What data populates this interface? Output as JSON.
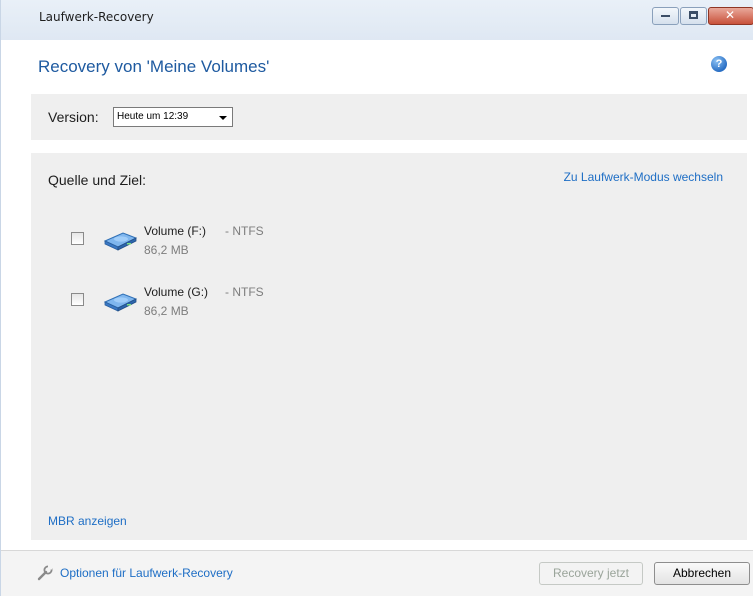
{
  "window": {
    "title": "Laufwerk-Recovery",
    "controls": {
      "minimize": "minimize-icon",
      "maximize": "maximize-icon",
      "close": "close-icon"
    }
  },
  "header": {
    "title": "Recovery von 'Meine Volumes'",
    "help_icon": "help-icon",
    "help_glyph": "?"
  },
  "version": {
    "label": "Version:",
    "selected": "Heute um 12:39"
  },
  "main": {
    "section_title": "Quelle und Ziel:",
    "switch_mode_link": "Zu Laufwerk-Modus wechseln",
    "volumes": [
      {
        "name": "Volume (F:)",
        "filesystem": "- NTFS",
        "size": "86,2 MB",
        "checked": false,
        "icon": "hard-drive-icon"
      },
      {
        "name": "Volume (G:)",
        "filesystem": "- NTFS",
        "size": "86,2 MB",
        "checked": false,
        "icon": "hard-drive-icon"
      }
    ],
    "mbr_link": "MBR anzeigen"
  },
  "footer": {
    "options_link": "Optionen für Laufwerk-Recovery",
    "options_icon": "wrench-icon",
    "recover_button": "Recovery jetzt",
    "recover_button_enabled": false,
    "cancel_button": "Abbrechen"
  },
  "colors": {
    "accent": "#1e5aa0",
    "link": "#1e6ec5",
    "panel_bg": "#efefef"
  }
}
